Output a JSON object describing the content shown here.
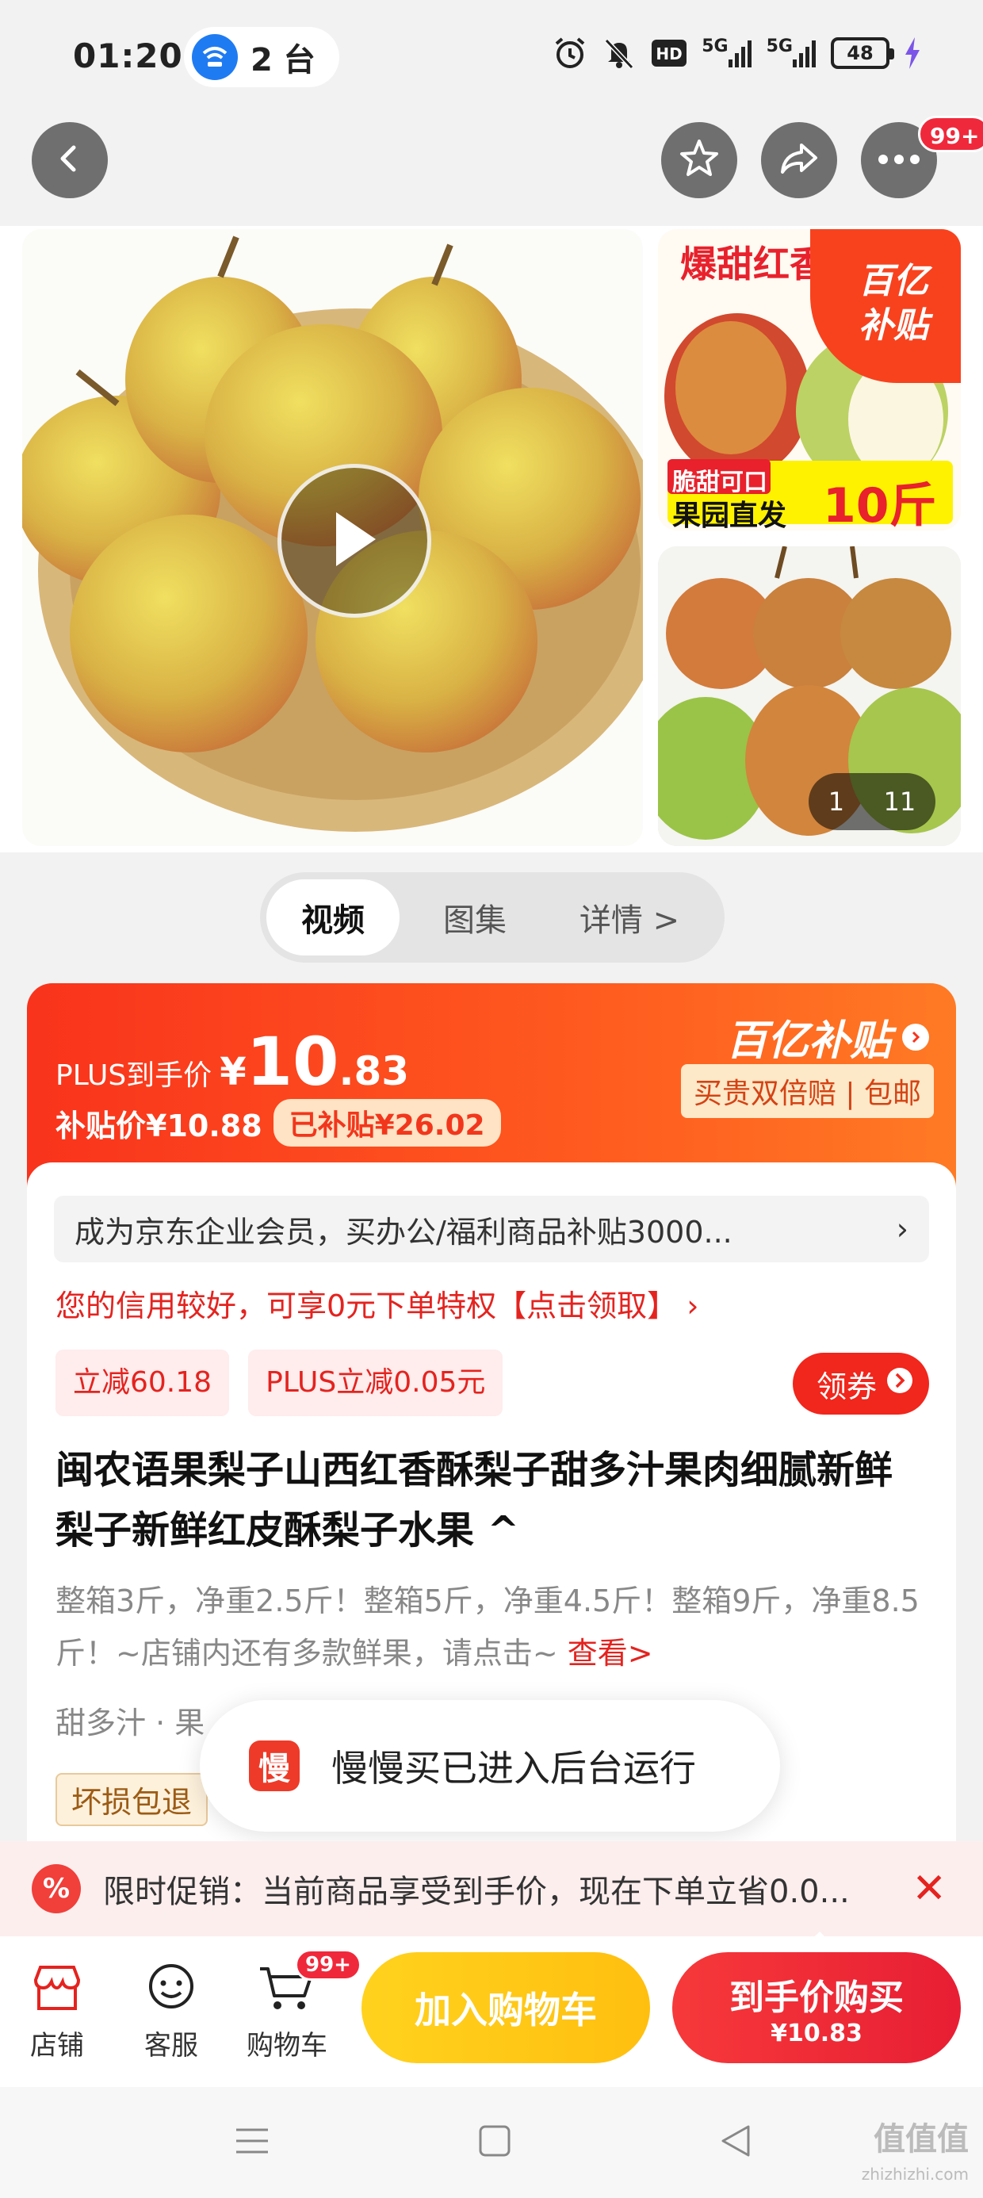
{
  "status_bar": {
    "time": "01:20",
    "hotspot_count": "2 台",
    "network_hd": "HD",
    "net1": "5G",
    "net2": "5G",
    "battery": "48"
  },
  "header": {
    "more_badge": "99+"
  },
  "gallery": {
    "side_banner_text": "爆甜红香",
    "side_banner_sub1": "脆甜可口",
    "side_banner_sub2": "果园直发",
    "side_banner_weight": "10斤",
    "subsidy_logo": "百亿补贴",
    "counter_current": "1",
    "counter_total": "11"
  },
  "tabs": [
    {
      "label": "视频"
    },
    {
      "label": "图集"
    },
    {
      "label": "详情 >"
    }
  ],
  "price": {
    "plus_label": "PLUS到手价",
    "yen": "¥",
    "int": "10",
    "dec": ".83",
    "subsidy_price": "补贴价¥10.88",
    "subsidized": "已补贴¥26.02",
    "program": "百亿补贴",
    "guarantee": "买贵双倍赔 | 包邮"
  },
  "info": {
    "member_text": "成为京东企业会员，买办公/福利商品补贴3000...",
    "member_arrow": "›",
    "credit": "您的信用较好，可享0元下单特权【点击领取】 ›",
    "coupons": [
      {
        "label": "立减60.18"
      },
      {
        "label": "PLUS立减0.05元"
      }
    ],
    "get_coupon": "领券",
    "title": "闽农语果梨子山西红香酥梨子甜多汁果肉细腻新鲜梨子新鲜红皮酥梨子水果 ^",
    "desc": "整箱3斤，净重2.5斤！整箱5斤，净重4.5斤！整箱9斤，净重8.5斤！~店铺内还有多款鲜果，请点击~",
    "desc_link": "查看>",
    "tags": "甜多汁 · 果",
    "tag_box": "坏损包退"
  },
  "toast": {
    "app_char": "慢",
    "message": "慢慢买已进入后台运行"
  },
  "promo": {
    "icon": "%",
    "text": "限时促销：当前商品享受到手价，现在下单立省0.0...",
    "close": "✕"
  },
  "bottom": {
    "shop": "店铺",
    "service": "客服",
    "cart": "购物车",
    "cart_badge": "99+",
    "add_cart": "加入购物车",
    "buy_now": "到手价购买",
    "buy_price": "¥10.83"
  },
  "watermark": {
    "main": "值值值",
    "sub": "zhizhizhi.com"
  },
  "colors": {
    "accent_red": "#e4231f",
    "subsidy_orange": "#f9331c",
    "cart_yellow": "#ffc417"
  }
}
